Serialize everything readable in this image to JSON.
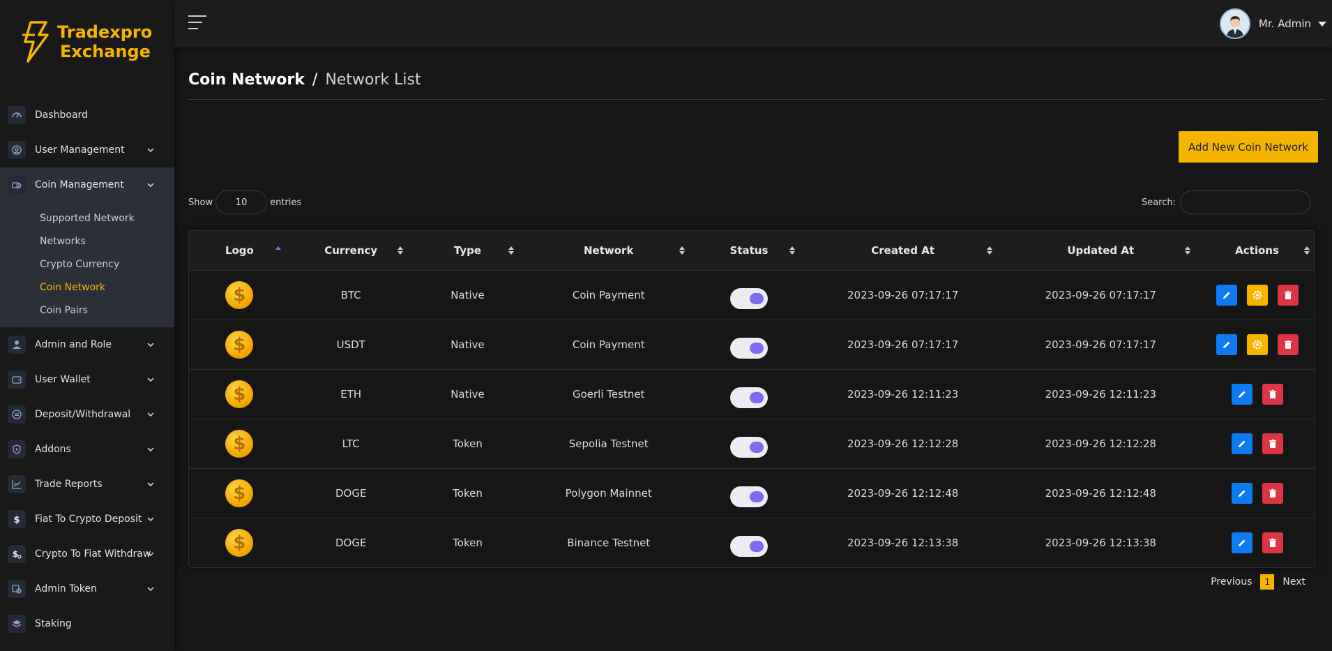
{
  "brand": {
    "line1": "Tradexpro",
    "line2": "Exchange"
  },
  "sidebar": {
    "items": [
      {
        "label": "Dashboard",
        "icon": "gauge-icon",
        "chevron": false
      },
      {
        "label": "User Management",
        "icon": "user-circle-icon",
        "chevron": true
      },
      {
        "label": "Coin Management",
        "icon": "coins-icon",
        "chevron": true,
        "open": true,
        "children": [
          "Supported Network",
          "Networks",
          "Crypto Currency",
          "Coin Network",
          "Coin Pairs"
        ],
        "active_child": "Coin Network"
      },
      {
        "label": "Admin and Role",
        "icon": "admin-icon",
        "chevron": true
      },
      {
        "label": "User Wallet",
        "icon": "wallet-icon",
        "chevron": true
      },
      {
        "label": "Deposit/Withdrawal",
        "icon": "exchange-icon",
        "chevron": true
      },
      {
        "label": "Addons",
        "icon": "shield-icon",
        "chevron": true
      },
      {
        "label": "Trade Reports",
        "icon": "chart-icon",
        "chevron": true
      },
      {
        "label": "Fiat To Crypto Deposit",
        "icon": "dollar-icon",
        "chevron": true
      },
      {
        "label": "Crypto To Fiat Withdraw",
        "icon": "dollar-convert-icon",
        "chevron": true
      },
      {
        "label": "Admin Token",
        "icon": "token-icon",
        "chevron": true
      },
      {
        "label": "Staking",
        "icon": "layers-icon",
        "chevron": false
      }
    ]
  },
  "topbar": {
    "user_name": "Mr. Admin"
  },
  "page": {
    "breadcrumb_main": "Coin Network",
    "breadcrumb_sep": "/",
    "breadcrumb_sub": "Network List",
    "add_button": "Add New Coin Network"
  },
  "table_controls": {
    "show_label": "Show",
    "entries_value": "10",
    "entries_label": "entries",
    "search_label": "Search:",
    "search_value": ""
  },
  "table": {
    "columns": [
      "Logo",
      "Currency",
      "Type",
      "Network",
      "Status",
      "Created At",
      "Updated At",
      "Actions"
    ],
    "rows": [
      {
        "currency": "BTC",
        "type": "Native",
        "network": "Coin Payment",
        "status": "on",
        "created": "2023-09-26 07:17:17",
        "updated": "2023-09-26 07:17:17",
        "actions": [
          "edit",
          "settings",
          "delete"
        ]
      },
      {
        "currency": "USDT",
        "type": "Native",
        "network": "Coin Payment",
        "status": "on",
        "created": "2023-09-26 07:17:17",
        "updated": "2023-09-26 07:17:17",
        "actions": [
          "edit",
          "settings",
          "delete"
        ]
      },
      {
        "currency": "ETH",
        "type": "Native",
        "network": "Goerli Testnet",
        "status": "on",
        "created": "2023-09-26 12:11:23",
        "updated": "2023-09-26 12:11:23",
        "actions": [
          "edit",
          "delete"
        ]
      },
      {
        "currency": "LTC",
        "type": "Token",
        "network": "Sepolia Testnet",
        "status": "on",
        "created": "2023-09-26 12:12:28",
        "updated": "2023-09-26 12:12:28",
        "actions": [
          "edit",
          "delete"
        ]
      },
      {
        "currency": "DOGE",
        "type": "Token",
        "network": "Polygon Mainnet",
        "status": "on",
        "created": "2023-09-26 12:12:48",
        "updated": "2023-09-26 12:12:48",
        "actions": [
          "edit",
          "delete"
        ]
      },
      {
        "currency": "DOGE",
        "type": "Token",
        "network": "Binance Testnet",
        "status": "on",
        "created": "2023-09-26 12:13:38",
        "updated": "2023-09-26 12:13:38",
        "actions": [
          "edit",
          "delete"
        ]
      }
    ]
  },
  "pagination": {
    "previous": "Previous",
    "current": "1",
    "next": "Next"
  },
  "colors": {
    "accent": "#f4b400",
    "edit": "#0d7cf2",
    "delete": "#dc3545",
    "toggle": "#7b6cf0"
  }
}
